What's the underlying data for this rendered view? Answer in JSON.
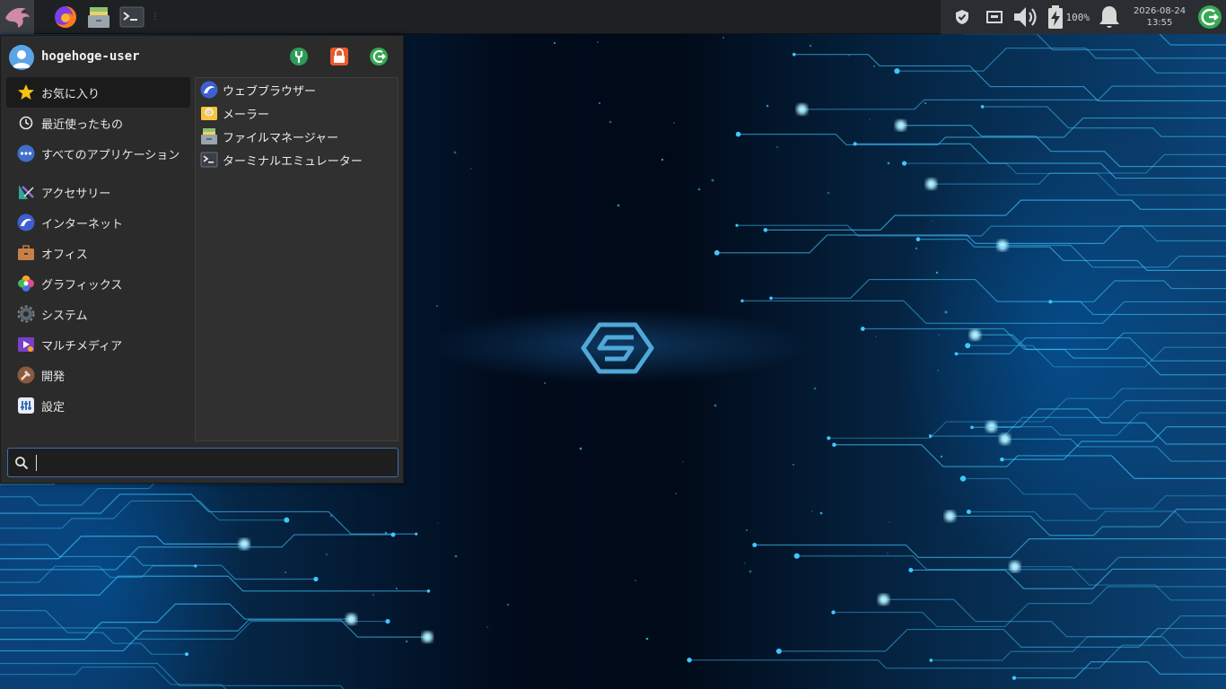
{
  "panel": {
    "battery_percent": "100%",
    "clock_date": "2026-08-24",
    "clock_time": "13:55"
  },
  "menu": {
    "username": "hogehoge-user",
    "categories": [
      {
        "label": "お気に入り",
        "icon": "star-icon"
      },
      {
        "label": "最近使ったもの",
        "icon": "clock-icon"
      },
      {
        "label": "すべてのアプリケーション",
        "icon": "dots-icon"
      },
      {
        "label": "アクセサリー",
        "icon": "accessories-icon"
      },
      {
        "label": "インターネット",
        "icon": "internet-icon"
      },
      {
        "label": "オフィス",
        "icon": "office-icon"
      },
      {
        "label": "グラフィックス",
        "icon": "graphics-icon"
      },
      {
        "label": "システム",
        "icon": "system-icon"
      },
      {
        "label": "マルチメディア",
        "icon": "multimedia-icon"
      },
      {
        "label": "開発",
        "icon": "development-icon"
      },
      {
        "label": "設定",
        "icon": "settings-icon"
      }
    ],
    "apps": [
      {
        "label": "ウェブブラウザー",
        "icon": "web-browser-icon"
      },
      {
        "label": "メーラー",
        "icon": "mail-icon"
      },
      {
        "label": "ファイルマネージャー",
        "icon": "file-manager-icon"
      },
      {
        "label": "ターミナルエミュレーター",
        "icon": "terminal-icon"
      }
    ],
    "search": {
      "value": "",
      "placeholder": ""
    }
  },
  "colors": {
    "accent": "#3b6fb8",
    "panel_bg": "#1e2124",
    "menu_bg": "#2b2b2b",
    "wallpaper_glow": "#3fc7ff"
  }
}
